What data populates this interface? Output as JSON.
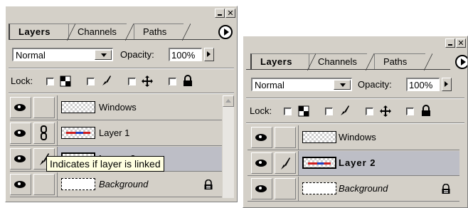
{
  "panels": [
    {
      "tabs": [
        "Layers",
        "Channels",
        "Paths"
      ],
      "blend_mode": "Normal",
      "opacity_label": "Opacity:",
      "opacity_value": "100%",
      "lock_label": "Lock:",
      "layers": [
        {
          "name": "Windows",
          "visible": true,
          "linked": false
        },
        {
          "name": "Layer 1",
          "visible": true,
          "linked": true
        },
        {
          "name": "Layer 2",
          "visible": true,
          "brush": true,
          "selected": true
        },
        {
          "name": "Background",
          "visible": true,
          "locked": true
        }
      ],
      "tooltip": "Indicates if layer is linked"
    },
    {
      "tabs": [
        "Layers",
        "Channels",
        "Paths"
      ],
      "blend_mode": "Normal",
      "opacity_label": "Opacity:",
      "opacity_value": "100%",
      "lock_label": "Lock:",
      "layers": [
        {
          "name": "Windows",
          "visible": true
        },
        {
          "name": "Layer 2",
          "visible": true,
          "brush": true,
          "selected": true
        },
        {
          "name": "Background",
          "visible": true,
          "locked": true
        }
      ]
    }
  ],
  "icons": {
    "eye": "eye-icon",
    "chain": "chain-link-icon",
    "brush": "brush-icon",
    "lock_transparent": "lock-transparency-icon",
    "lock_image": "lock-image-icon",
    "lock_position": "lock-position-icon",
    "lock_all": "lock-all-icon",
    "menu": "palette-menu-icon"
  }
}
